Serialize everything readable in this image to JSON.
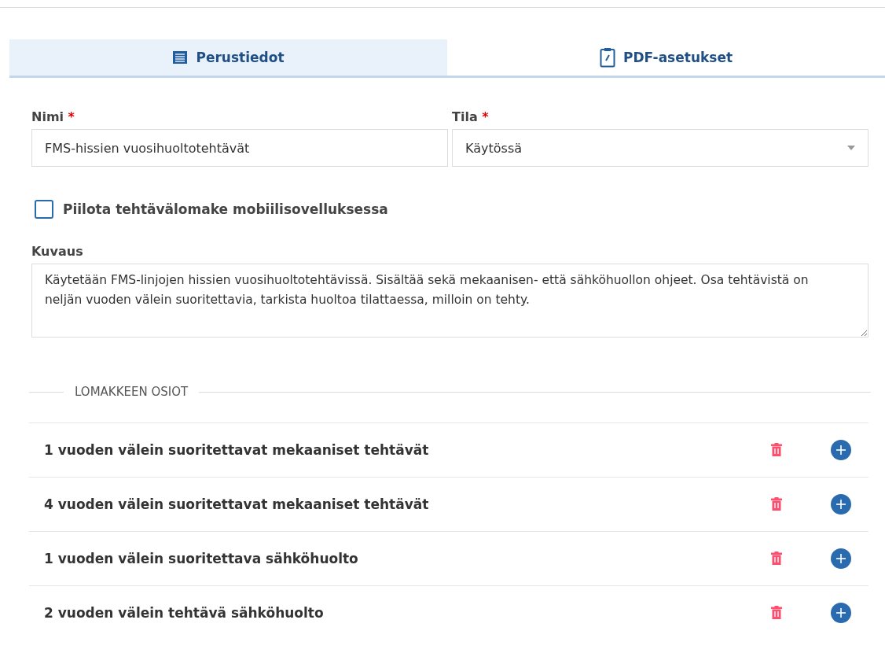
{
  "tabs": [
    {
      "label": "Perustiedot",
      "kind": "list",
      "selected": true
    },
    {
      "label": "PDF-asetukset",
      "kind": "clipboard",
      "selected": false
    }
  ],
  "fields": {
    "name": {
      "label": "Nimi",
      "required_mark": "*",
      "value": "FMS-hissien vuosihuoltotehtävät"
    },
    "status": {
      "label": "Tila",
      "required_mark": "*",
      "value": "Käytössä"
    }
  },
  "hide_checkbox": {
    "label": "Piilota tehtävälomake mobiilisovelluksessa",
    "checked": false
  },
  "description": {
    "label": "Kuvaus",
    "value": "Käytetään FMS-linjojen hissien vuosihuoltotehtävissä. Sisältää sekä mekaanisen- että sähköhuollon ohjeet. Osa tehtävistä on neljän vuoden välein suoritettavia, tarkista huoltoa tilattaessa, milloin on tehty."
  },
  "sections": {
    "heading": "LOMAKKEEN OSIOT",
    "items": [
      {
        "title": "1 vuoden välein suoritettavat mekaaniset tehtävät"
      },
      {
        "title": "4 vuoden välein suoritettavat mekaaniset tehtävät"
      },
      {
        "title": "1 vuoden välein suoritettava sähköhuolto"
      },
      {
        "title": "2 vuoden välein tehtävä sähköhuolto"
      }
    ]
  }
}
